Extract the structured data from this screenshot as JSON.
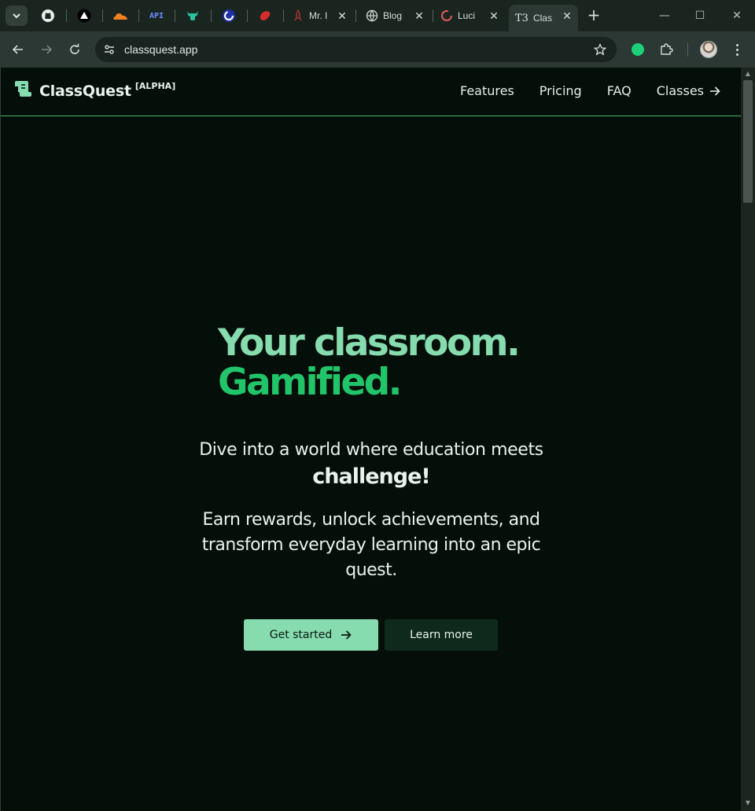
{
  "browser": {
    "tabs": [
      {
        "icon": "chevron-down-icon"
      },
      {
        "icon": "github-icon"
      },
      {
        "icon": "vercel-triangle-icon"
      },
      {
        "icon": "cloudflare-icon"
      },
      {
        "icon": "api-icon",
        "text": "API"
      },
      {
        "icon": "bull-icon"
      },
      {
        "icon": "c-circle-icon"
      },
      {
        "icon": "red-blob-icon"
      },
      {
        "title": "Mr. I",
        "icon": "rocket-icon"
      },
      {
        "title": "Blog",
        "icon": "globe-icon"
      },
      {
        "title": "Luci",
        "icon": "lucia-icon"
      },
      {
        "title": "Clas",
        "icon": "t3-icon",
        "icon_text": "T3",
        "active": true
      }
    ],
    "close_symbol": "✕",
    "new_tab_symbol": "+",
    "window_controls": {
      "minimize": "—",
      "maximize": "☐",
      "close": "✕"
    },
    "url": "classquest.app"
  },
  "site": {
    "brand": {
      "name": "ClassQuest",
      "tag": "[ALPHA]"
    },
    "nav": [
      "Features",
      "Pricing",
      "FAQ",
      "Classes"
    ],
    "hero": {
      "headline_1": "Your classroom.",
      "headline_2": "Gamified.",
      "subhead": "Dive into a world where education meets",
      "subhead_bold": "challenge!",
      "lede": "Earn rewards, unlock achievements, and transform everyday learning into an epic quest.",
      "primary_cta": "Get started",
      "secondary_cta": "Learn more"
    }
  },
  "colors": {
    "page_bg": "#040f0a",
    "accent_light": "#86dcaf",
    "accent": "#22c46a",
    "nav_border": "#4fb06a"
  }
}
